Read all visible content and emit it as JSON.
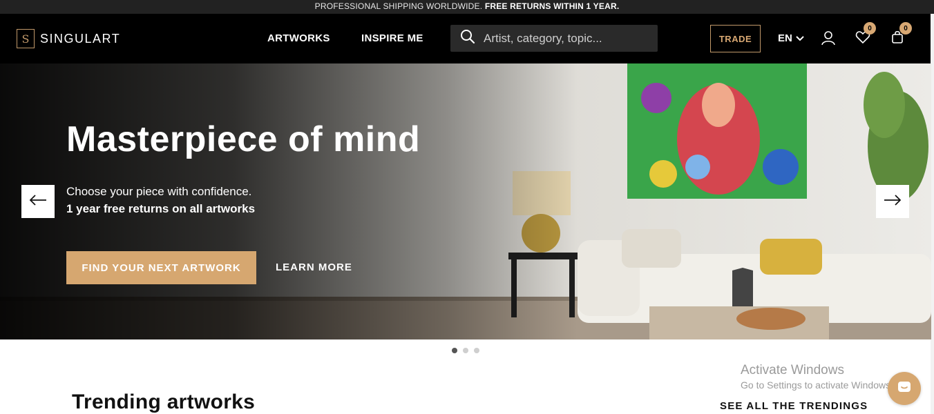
{
  "topbar": {
    "text_normal": "PROFESSIONAL SHIPPING WORLDWIDE.",
    "text_bold": "FREE RETURNS WITHIN 1 YEAR."
  },
  "nav": {
    "logo_mark": "S",
    "logo_text": "SINGULART",
    "links": [
      {
        "label": "ARTWORKS"
      },
      {
        "label": "INSPIRE ME"
      }
    ],
    "search_placeholder": "Artist, category, topic...",
    "trade_label": "TRADE",
    "language": "EN",
    "wishlist_count": "0",
    "cart_count": "0"
  },
  "hero": {
    "title": "Masterpiece of mind",
    "subtitle": "Choose your piece with confidence.",
    "subtitle_bold": "1 year free returns on all artworks",
    "cta_label": "FIND YOUR NEXT ARTWORK",
    "learn_more_label": "LEARN MORE",
    "slides": {
      "current": 1,
      "total": 3
    }
  },
  "trending": {
    "title": "Trending artworks",
    "see_all_label": "SEE ALL THE TRENDINGS"
  },
  "watermark": {
    "line1": "Activate Windows",
    "line2": "Go to Settings to activate Windows."
  },
  "colors": {
    "accent": "#d6a770",
    "nav_bg": "#000000",
    "topbar_bg": "#222222"
  },
  "icons": {
    "search": "search-icon",
    "user": "user-icon",
    "heart": "heart-icon",
    "bag": "shopping-bag-icon",
    "chevron": "chevron-down-icon",
    "arrow_left": "arrow-left-icon",
    "arrow_right": "arrow-right-icon",
    "chat": "chat-icon"
  }
}
